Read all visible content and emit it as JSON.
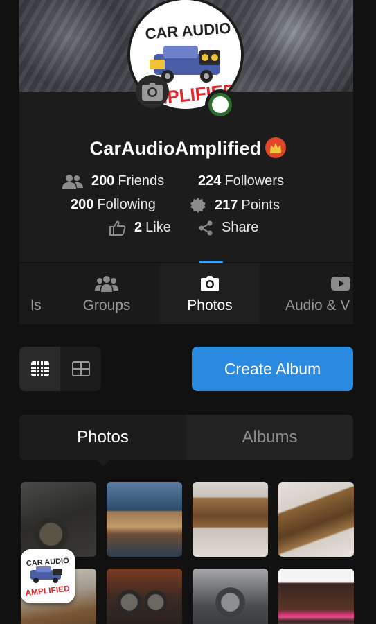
{
  "profile": {
    "logo_text_line1": "CAR AUDIO",
    "logo_text_line2": "AMPLIFIED",
    "username": "CarAudioAmplified",
    "friends_count": "200",
    "friends_label": "Friends",
    "followers_count": "224",
    "followers_label": "Followers",
    "following_count": "200",
    "following_label": "Following",
    "points_count": "217",
    "points_label": "Points",
    "likes_count": "2",
    "likes_label": "Like",
    "share_label": "Share"
  },
  "tabs": [
    {
      "label": "ls",
      "icon": "partial"
    },
    {
      "label": "Groups",
      "icon": "groups-icon"
    },
    {
      "label": "Photos",
      "icon": "camera-icon",
      "active": true
    },
    {
      "label": "Audio & V",
      "icon": "video-icon"
    }
  ],
  "toolbar": {
    "create_album_label": "Create Album"
  },
  "segment": {
    "photos_label": "Photos",
    "albums_label": "Albums"
  },
  "colors": {
    "accent": "#2a8be0",
    "tab_indicator": "#3aa3ff",
    "background": "#111111",
    "card": "#1c1c1c"
  }
}
